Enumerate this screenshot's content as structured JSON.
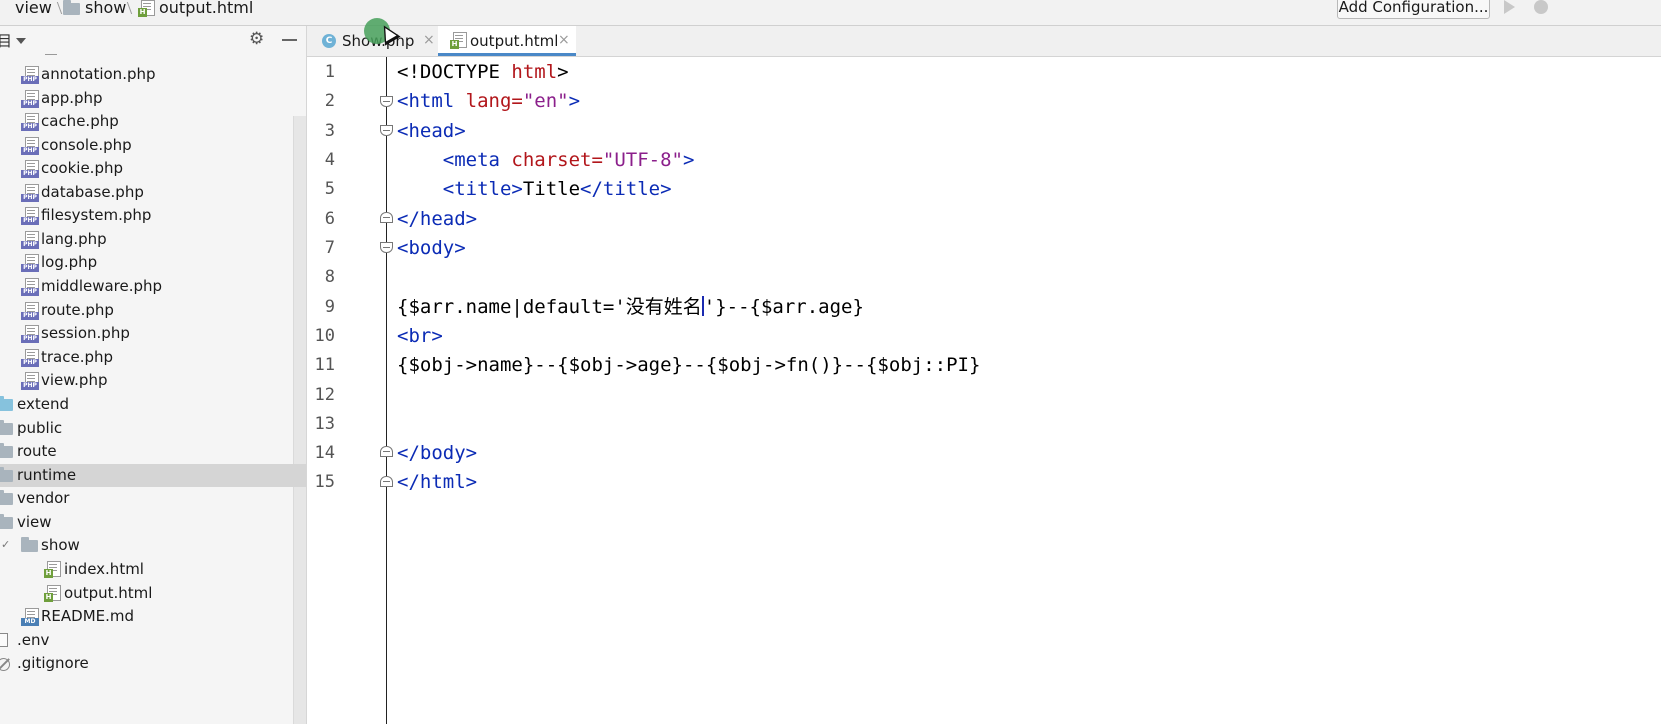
{
  "breadcrumb": {
    "items": [
      "view",
      "show",
      "output.html"
    ]
  },
  "toolbar": {
    "add_configuration": "Add Configuration..."
  },
  "sidebar": {
    "title": "目",
    "files": [
      "annotation.php",
      "app.php",
      "cache.php",
      "console.php",
      "cookie.php",
      "database.php",
      "filesystem.php",
      "lang.php",
      "log.php",
      "middleware.php",
      "route.php",
      "session.php",
      "trace.php",
      "view.php"
    ],
    "folders": [
      "extend",
      "public",
      "route",
      "runtime",
      "vendor",
      "view",
      "show"
    ],
    "show_files": [
      "index.html",
      "output.html"
    ],
    "readme": "README.md",
    "env": ".env",
    "gitignore": ".gitignore",
    "selected": "runtime"
  },
  "tabs": [
    {
      "label": "Show.php",
      "active": false
    },
    {
      "label": "output.html",
      "active": true
    }
  ],
  "editor": {
    "line_numbers": [
      "1",
      "2",
      "3",
      "4",
      "5",
      "6",
      "7",
      "8",
      "9",
      "10",
      "11",
      "12",
      "13",
      "14",
      "15"
    ],
    "code": {
      "l1_a": "<!DOCTYPE ",
      "l1_b": "html",
      "l1_c": ">",
      "l2_a": "<html ",
      "l2_b": "lang=",
      "l2_c": "\"en\"",
      "l2_d": ">",
      "l3_a": "<head>",
      "l4_a": "    <meta ",
      "l4_b": "charset=",
      "l4_c": "\"UTF-8\"",
      "l4_d": ">",
      "l5_a": "    <title>",
      "l5_b": "Title",
      "l5_c": "</title>",
      "l6_a": "</head>",
      "l7_a": "<body>",
      "l9_a": "{$arr.name|default='没有姓名",
      "l9_b": "'}--{$arr.age}",
      "l10_a": "<br>",
      "l11_a": "{$obj->name}--{$obj->age}--{$obj->fn()}--{$obj::PI}",
      "l14_a": "</body>",
      "l15_a": "</html>"
    }
  },
  "colors": {
    "tag": "#0b2bb5",
    "attr": "#b2161b",
    "string": "#8b1f8b",
    "active_tab_underline": "#4a88c7",
    "selected_row": "#d5d5d5"
  }
}
